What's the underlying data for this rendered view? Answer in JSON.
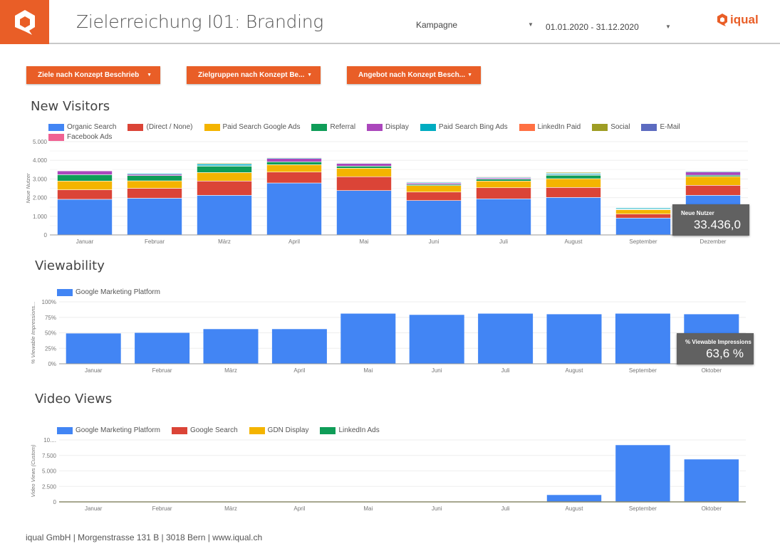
{
  "header": {
    "title": "Zielerreichung I01: Branding",
    "campaign_label": "Kampagne",
    "date_range": "01.01.2020 - 31.12.2020",
    "brand": "iqual"
  },
  "filters": [
    {
      "label": "Ziele nach Konzept Beschrieb"
    },
    {
      "label": "Zielgruppen nach Konzept Be..."
    },
    {
      "label": "Angebot nach Konzept Besch..."
    }
  ],
  "colors": {
    "accent": "#e95e27",
    "blue": "#4285f4",
    "red": "#db4437",
    "yellow": "#f4b400",
    "green": "#0f9d58"
  },
  "sections": {
    "visitors": "New Visitors",
    "viewability": "Viewability",
    "video": "Video Views"
  },
  "chart_data": [
    {
      "type": "bar",
      "stacked": true,
      "title": "New Visitors",
      "ylabel": "Neue Nutzer",
      "ylim": [
        0,
        5000
      ],
      "yticks": [
        "0",
        "1.000",
        "2.000",
        "3.000",
        "4.000",
        "5.000"
      ],
      "grid": true,
      "legend": "top",
      "categories": [
        "Januar",
        "Februar",
        "März",
        "April",
        "Mai",
        "Juni",
        "Juli",
        "August",
        "September",
        "Dezember"
      ],
      "series": [
        {
          "name": "Organic Search",
          "color": "#4285f4",
          "values": [
            1910,
            1970,
            2125,
            2785,
            2380,
            1845,
            1935,
            2010,
            905,
            2125
          ]
        },
        {
          "name": "(Direct / None)",
          "color": "#db4437",
          "values": [
            510,
            530,
            765,
            585,
            740,
            455,
            595,
            535,
            215,
            535
          ]
        },
        {
          "name": "Paid Search Google Ads",
          "color": "#f4b400",
          "values": [
            470,
            400,
            455,
            395,
            455,
            345,
            360,
            470,
            230,
            470
          ]
        },
        {
          "name": "Referral",
          "color": "#0f9d58",
          "values": [
            340,
            280,
            345,
            155,
            115,
            60,
            100,
            185,
            20,
            70
          ]
        },
        {
          "name": "Display",
          "color": "#ab47bc",
          "values": [
            205,
            70,
            20,
            175,
            140,
            70,
            60,
            30,
            20,
            170
          ]
        },
        {
          "name": "Paid Search Bing Ads",
          "color": "#00acc1",
          "values": [
            20,
            60,
            100,
            40,
            30,
            40,
            40,
            60,
            60,
            40
          ]
        },
        {
          "name": "LinkedIn Paid",
          "color": "#ff7043",
          "values": [
            20,
            10,
            10,
            30,
            30,
            30,
            30,
            20,
            20,
            30
          ]
        },
        {
          "name": "Social",
          "color": "#9e9d24",
          "values": [
            10,
            10,
            50,
            20,
            20,
            20,
            30,
            50,
            10,
            20
          ]
        },
        {
          "name": "E-Mail",
          "color": "#5c6bc0",
          "values": [
            10,
            10,
            10,
            10,
            10,
            10,
            10,
            20,
            10,
            20
          ]
        },
        {
          "name": "Facebook Ads",
          "color": "#f06292",
          "values": [
            5,
            10,
            5,
            5,
            20,
            20,
            10,
            20,
            0,
            20
          ]
        }
      ],
      "tooltip": {
        "label": "Neue Nutzer",
        "value": "33.436,0"
      }
    },
    {
      "type": "bar",
      "title": "Viewability",
      "ylabel": "% Viewable Impressions...",
      "ylim": [
        0,
        100
      ],
      "yticks": [
        "0%",
        "25%",
        "50%",
        "75%",
        "100%"
      ],
      "grid": true,
      "legend": "top",
      "categories": [
        "Januar",
        "Februar",
        "März",
        "April",
        "Mai",
        "Juni",
        "Juli",
        "August",
        "September",
        "Oktober"
      ],
      "series": [
        {
          "name": "Google Marketing Platform",
          "color": "#4285f4",
          "values": [
            49,
            50,
            56,
            56,
            81,
            79,
            81,
            80,
            81,
            80
          ]
        }
      ],
      "tooltip": {
        "label": "% Viewable Impressions",
        "value": "63,6 %"
      }
    },
    {
      "type": "bar",
      "stacked": true,
      "title": "Video Views",
      "ylabel": "Video Views (Custom)",
      "ylim": [
        0,
        10000
      ],
      "yticks": [
        "0",
        "2.500",
        "5.000",
        "7.500",
        "10...."
      ],
      "grid": true,
      "legend": "top",
      "categories": [
        "Januar",
        "Februar",
        "März",
        "April",
        "Mai",
        "Juni",
        "Juli",
        "August",
        "September",
        "Oktober"
      ],
      "series": [
        {
          "name": "Google Marketing Platform",
          "color": "#4285f4",
          "values": [
            0,
            0,
            0,
            0,
            0,
            0,
            0,
            1150,
            9200,
            6900
          ]
        },
        {
          "name": "Google Search",
          "color": "#db4437",
          "values": [
            0,
            0,
            0,
            0,
            0,
            0,
            0,
            0,
            0,
            0
          ]
        },
        {
          "name": "GDN Display",
          "color": "#f4b400",
          "values": [
            0,
            0,
            0,
            0,
            0,
            0,
            0,
            0,
            0,
            0
          ]
        },
        {
          "name": "LinkedIn Ads",
          "color": "#0f9d58",
          "values": [
            0,
            0,
            0,
            0,
            0,
            0,
            0,
            0,
            0,
            0
          ]
        }
      ]
    }
  ],
  "footer": "iqual GmbH | Morgenstrasse 131 B | 3018 Bern | www.iqual.ch"
}
